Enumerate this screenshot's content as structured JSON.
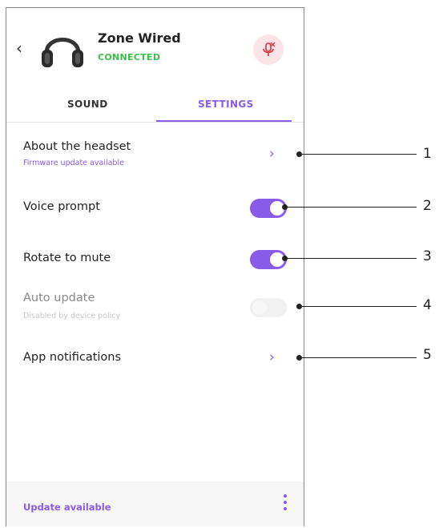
{
  "header": {
    "device_name": "Zone Wired",
    "status": "CONNECTED",
    "back_icon": "chevron-left-icon",
    "mute_icon": "microphone-muted-icon"
  },
  "tabs": [
    {
      "label": "SOUND",
      "active": false
    },
    {
      "label": "SETTINGS",
      "active": true
    }
  ],
  "settings": {
    "about": {
      "label": "About the headset",
      "sub": "Firmware update available"
    },
    "voice_prompt": {
      "label": "Voice prompt",
      "on": true
    },
    "rotate_to_mute": {
      "label": "Rotate to mute",
      "on": true
    },
    "auto_update": {
      "label": "Auto update",
      "sub": "Disabled by device policy",
      "on": false,
      "disabled": true
    },
    "app_notifications": {
      "label": "App notifications"
    }
  },
  "footer": {
    "update_text": "Update available",
    "menu_icon": "more-vertical-icon"
  },
  "callouts": [
    "1",
    "2",
    "3",
    "4",
    "5"
  ],
  "colors": {
    "accent": "#8a5be8",
    "connected": "#39c04a",
    "mute_bg": "#fbe3e6",
    "mute_icon": "#d9434f"
  }
}
